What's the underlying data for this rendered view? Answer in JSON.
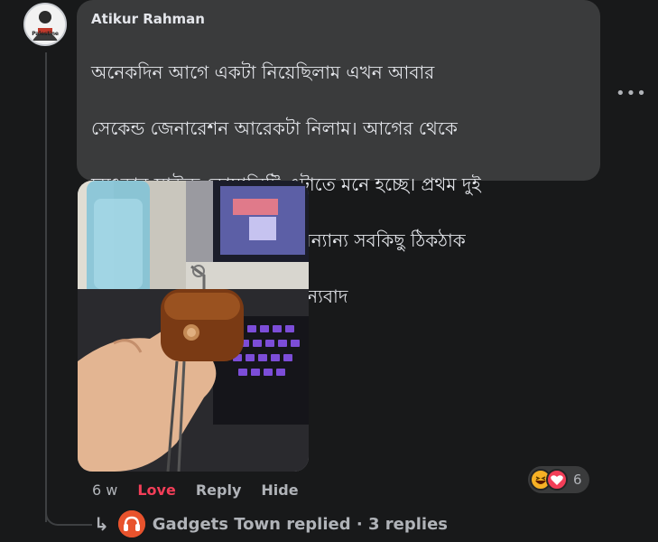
{
  "comment": {
    "author": "Atikur Rahman",
    "avatar_caption": "Palestine",
    "lines": [
      "অনেকদিন আগে একটা নিয়েছিলাম এখন আবার",
      "সেকেন্ড জেনারেশন আরেকটা নিলাম। আগের থেকে",
      "চমৎকার সাউন্ড কোয়ালিটি এটাতে মনে হচ্ছে। প্রথম দুই",
      "দিনে ব্যাটারি ব্যাকআপ এবং অন্যান্য সবকিছু ঠিকঠাক",
      "পাচ্ছি বাকিটা আল্লাহ ভরসা, ধন্যবাদ"
    ],
    "more_icon": "ellipsis-icon",
    "more_label": "•••"
  },
  "photo": {
    "icon": "photo-airpods-leather-case"
  },
  "actions": {
    "time": "6 w",
    "love": "Love",
    "reply": "Reply",
    "hide": "Hide"
  },
  "reactions": {
    "icons": [
      "haha-icon",
      "love-icon"
    ],
    "count": "6"
  },
  "replies": {
    "arrow": "↳",
    "text": "Gadgets Town replied · 3 replies"
  },
  "colors": {
    "background": "#18191a",
    "bubble": "#3a3b3c",
    "text": "#e4e6eb",
    "muted": "#b0b3b8",
    "love": "#f33e58",
    "haha": "#f7b125",
    "brand_orange": "#e8532d"
  }
}
